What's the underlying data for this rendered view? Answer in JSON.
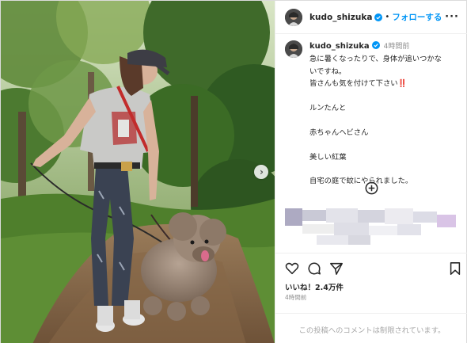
{
  "post": {
    "username": "kudo_shizuka",
    "follow_label": "フォローする",
    "more_label": "···",
    "caption": {
      "time": "4時間前",
      "lines": [
        "急に暑くなったりで、身体が追いつかな",
        "いですね。",
        "皆さんも気を付けて下さい‼️",
        "",
        "ルンたんと",
        "",
        "赤ちゃんヘビさん",
        "",
        "美しい紅葉",
        "",
        "自宅の庭で蚊にやられました。"
      ]
    },
    "likes_label": "いいね！2.4万件",
    "posted_time": "4時間前",
    "comments_disabled": "この投稿へのコメントは制限されています。"
  },
  "icons": {
    "verified": "verified-badge-icon",
    "like": "heart-icon",
    "comment": "comment-icon",
    "share": "send-icon",
    "save": "bookmark-icon",
    "load_more": "plus-circle-icon",
    "next": "chevron-right-icon"
  },
  "colors": {
    "accent": "#0095f6",
    "verified": "#0095f6",
    "muted": "#8e8e8e",
    "text": "#262626"
  }
}
